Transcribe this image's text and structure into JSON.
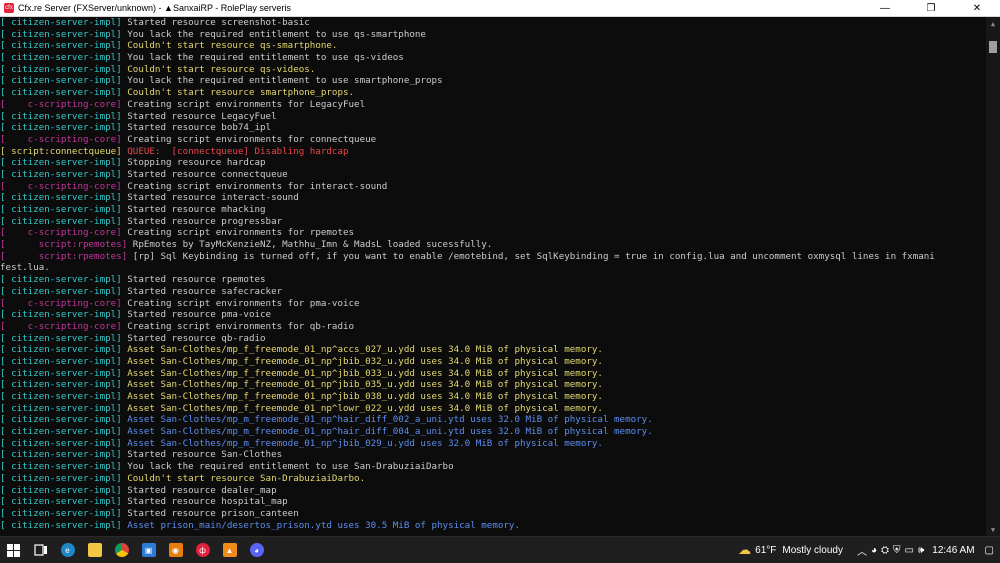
{
  "window": {
    "title": "Cfx.re Server (FXServer/unknown) - ▲SanxaiRP - RolePlay serveris",
    "minimize": "—",
    "maximize": "❐",
    "close": "✕"
  },
  "colors": {
    "tag": "#33c9c9",
    "script": "#c0369b",
    "warn": "#f0e68c",
    "error": "#f25a5a",
    "blue": "#5c8ef0",
    "green": "#3bc23b"
  },
  "console": {
    "lines": [
      {
        "tag": "[ citizen-server-impl]",
        "tagc": "tag",
        "msg": "Started resource screenshot-basic",
        "msgc": ""
      },
      {
        "tag": "[ citizen-server-impl]",
        "tagc": "tag",
        "msg": "You lack the required entitlement to use qs-smartphone",
        "msgc": ""
      },
      {
        "tag": "[ citizen-server-impl]",
        "tagc": "tag",
        "msg": "Couldn't start resource qs-smartphone.",
        "msgc": "warn"
      },
      {
        "tag": "[ citizen-server-impl]",
        "tagc": "tag",
        "msg": "You lack the required entitlement to use qs-videos",
        "msgc": ""
      },
      {
        "tag": "[ citizen-server-impl]",
        "tagc": "tag",
        "msg": "Couldn't start resource qs-videos.",
        "msgc": "warn"
      },
      {
        "tag": "[ citizen-server-impl]",
        "tagc": "tag",
        "msg": "You lack the required entitlement to use smartphone_props",
        "msgc": ""
      },
      {
        "tag": "[ citizen-server-impl]",
        "tagc": "tag",
        "msg": "Couldn't start resource smartphone_props.",
        "msgc": "warn"
      },
      {
        "tag": "[    c-scripting-core]",
        "tagc": "script",
        "msg": "Creating script environments for LegacyFuel",
        "msgc": ""
      },
      {
        "tag": "[ citizen-server-impl]",
        "tagc": "tag",
        "msg": "Started resource LegacyFuel",
        "msgc": ""
      },
      {
        "tag": "[ citizen-server-impl]",
        "tagc": "tag",
        "msg": "Started resource bob74_ipl",
        "msgc": ""
      },
      {
        "tag": "[    c-scripting-core]",
        "tagc": "script",
        "msg": "Creating script environments for connectqueue",
        "msgc": ""
      },
      {
        "tag": "[ script:connectqueue]",
        "tagc": "warn",
        "msg": "QUEUE:  [connectqueue] Disabling hardcap",
        "msgc": "err"
      },
      {
        "tag": "[ citizen-server-impl]",
        "tagc": "tag",
        "msg": "Stopping resource hardcap",
        "msgc": ""
      },
      {
        "tag": "[ citizen-server-impl]",
        "tagc": "tag",
        "msg": "Started resource connectqueue",
        "msgc": ""
      },
      {
        "tag": "[    c-scripting-core]",
        "tagc": "script",
        "msg": "Creating script environments for interact-sound",
        "msgc": ""
      },
      {
        "tag": "[ citizen-server-impl]",
        "tagc": "tag",
        "msg": "Started resource interact-sound",
        "msgc": ""
      },
      {
        "tag": "[ citizen-server-impl]",
        "tagc": "tag",
        "msg": "Started resource mhacking",
        "msgc": ""
      },
      {
        "tag": "[ citizen-server-impl]",
        "tagc": "tag",
        "msg": "Started resource progressbar",
        "msgc": ""
      },
      {
        "tag": "[    c-scripting-core]",
        "tagc": "script",
        "msg": "Creating script environments for rpemotes",
        "msgc": ""
      },
      {
        "tag": "[      script:rpemotes]",
        "tagc": "script",
        "msg": "RpEmotes by TayMcKenzieNZ, Mathhu_Imn & MadsL loaded sucessfully.",
        "msgc": ""
      },
      {
        "tag": "[      script:rpemotes]",
        "tagc": "script",
        "msg": "[rp] Sql Keybinding is turned off, if you want to enable /emotebind, set SqlKeybinding = true in config.lua and uncomment oxmysql lines in fxmani",
        "msgc": ""
      },
      {
        "tag": "",
        "tagc": "",
        "msg": "fest.lua.",
        "msgc": ""
      },
      {
        "tag": "[ citizen-server-impl]",
        "tagc": "tag",
        "msg": "Started resource rpemotes",
        "msgc": ""
      },
      {
        "tag": "[ citizen-server-impl]",
        "tagc": "tag",
        "msg": "Started resource safecracker",
        "msgc": ""
      },
      {
        "tag": "[    c-scripting-core]",
        "tagc": "script",
        "msg": "Creating script environments for pma-voice",
        "msgc": ""
      },
      {
        "tag": "[ citizen-server-impl]",
        "tagc": "tag",
        "msg": "Started resource pma-voice",
        "msgc": ""
      },
      {
        "tag": "[    c-scripting-core]",
        "tagc": "script",
        "msg": "Creating script environments for qb-radio",
        "msgc": ""
      },
      {
        "tag": "[ citizen-server-impl]",
        "tagc": "tag",
        "msg": "Started resource qb-radio",
        "msgc": ""
      },
      {
        "tag": "[ citizen-server-impl]",
        "tagc": "tag",
        "msg": "Asset San-Clothes/mp_f_freemode_01_np^accs_027_u.ydd uses 34.0 MiB of physical memory.",
        "msgc": "warn"
      },
      {
        "tag": "[ citizen-server-impl]",
        "tagc": "tag",
        "msg": "Asset San-Clothes/mp_f_freemode_01_np^jbib_032_u.ydd uses 34.0 MiB of physical memory.",
        "msgc": "warn"
      },
      {
        "tag": "[ citizen-server-impl]",
        "tagc": "tag",
        "msg": "Asset San-Clothes/mp_f_freemode_01_np^jbib_033_u.ydd uses 34.0 MiB of physical memory.",
        "msgc": "warn"
      },
      {
        "tag": "[ citizen-server-impl]",
        "tagc": "tag",
        "msg": "Asset San-Clothes/mp_f_freemode_01_np^jbib_035_u.ydd uses 34.0 MiB of physical memory.",
        "msgc": "warn"
      },
      {
        "tag": "[ citizen-server-impl]",
        "tagc": "tag",
        "msg": "Asset San-Clothes/mp_f_freemode_01_np^jbib_038_u.ydd uses 34.0 MiB of physical memory.",
        "msgc": "warn"
      },
      {
        "tag": "[ citizen-server-impl]",
        "tagc": "tag",
        "msg": "Asset San-Clothes/mp_f_freemode_01_np^lowr_022_u.ydd uses 34.0 MiB of physical memory.",
        "msgc": "warn"
      },
      {
        "tag": "[ citizen-server-impl]",
        "tagc": "tag",
        "msg": "Asset San-Clothes/mp_m_freemode_01_np^hair_diff_002_a_uni.ytd uses 32.0 MiB of physical memory.",
        "msgc": "blue"
      },
      {
        "tag": "[ citizen-server-impl]",
        "tagc": "tag",
        "msg": "Asset San-Clothes/mp_m_freemode_01_np^hair_diff_004_a_uni.ytd uses 32.0 MiB of physical memory.",
        "msgc": "blue"
      },
      {
        "tag": "[ citizen-server-impl]",
        "tagc": "tag",
        "msg": "Asset San-Clothes/mp_m_freemode_01_np^jbib_029_u.ydd uses 32.0 MiB of physical memory.",
        "msgc": "blue"
      },
      {
        "tag": "[ citizen-server-impl]",
        "tagc": "tag",
        "msg": "Started resource San-Clothes",
        "msgc": ""
      },
      {
        "tag": "[ citizen-server-impl]",
        "tagc": "tag",
        "msg": "You lack the required entitlement to use San-DrabuziaiDarbo",
        "msgc": ""
      },
      {
        "tag": "[ citizen-server-impl]",
        "tagc": "tag",
        "msg": "Couldn't start resource San-DrabuziaiDarbo.",
        "msgc": "warn"
      },
      {
        "tag": "[ citizen-server-impl]",
        "tagc": "tag",
        "msg": "Started resource dealer_map",
        "msgc": ""
      },
      {
        "tag": "[ citizen-server-impl]",
        "tagc": "tag",
        "msg": "Started resource hospital_map",
        "msgc": ""
      },
      {
        "tag": "[ citizen-server-impl]",
        "tagc": "tag",
        "msg": "Started resource prison_canteen",
        "msgc": ""
      },
      {
        "tag": "[ citizen-server-impl]",
        "tagc": "tag",
        "msg": "Asset prison_main/desertos_prison.ytd uses 30.5 MiB of physical memory.",
        "msgc": "blue"
      }
    ]
  },
  "taskbar": {
    "weather_temp": "61°F",
    "weather_text": "Mostly cloudy",
    "clock": "12:46 AM",
    "icons": [
      "windows-start-icon",
      "task-view-icon",
      "edge-icon",
      "file-explorer-icon",
      "chrome-icon",
      "app-icon",
      "blender-icon",
      "fivem-icon",
      "vlc-icon",
      "discord-icon"
    ]
  }
}
